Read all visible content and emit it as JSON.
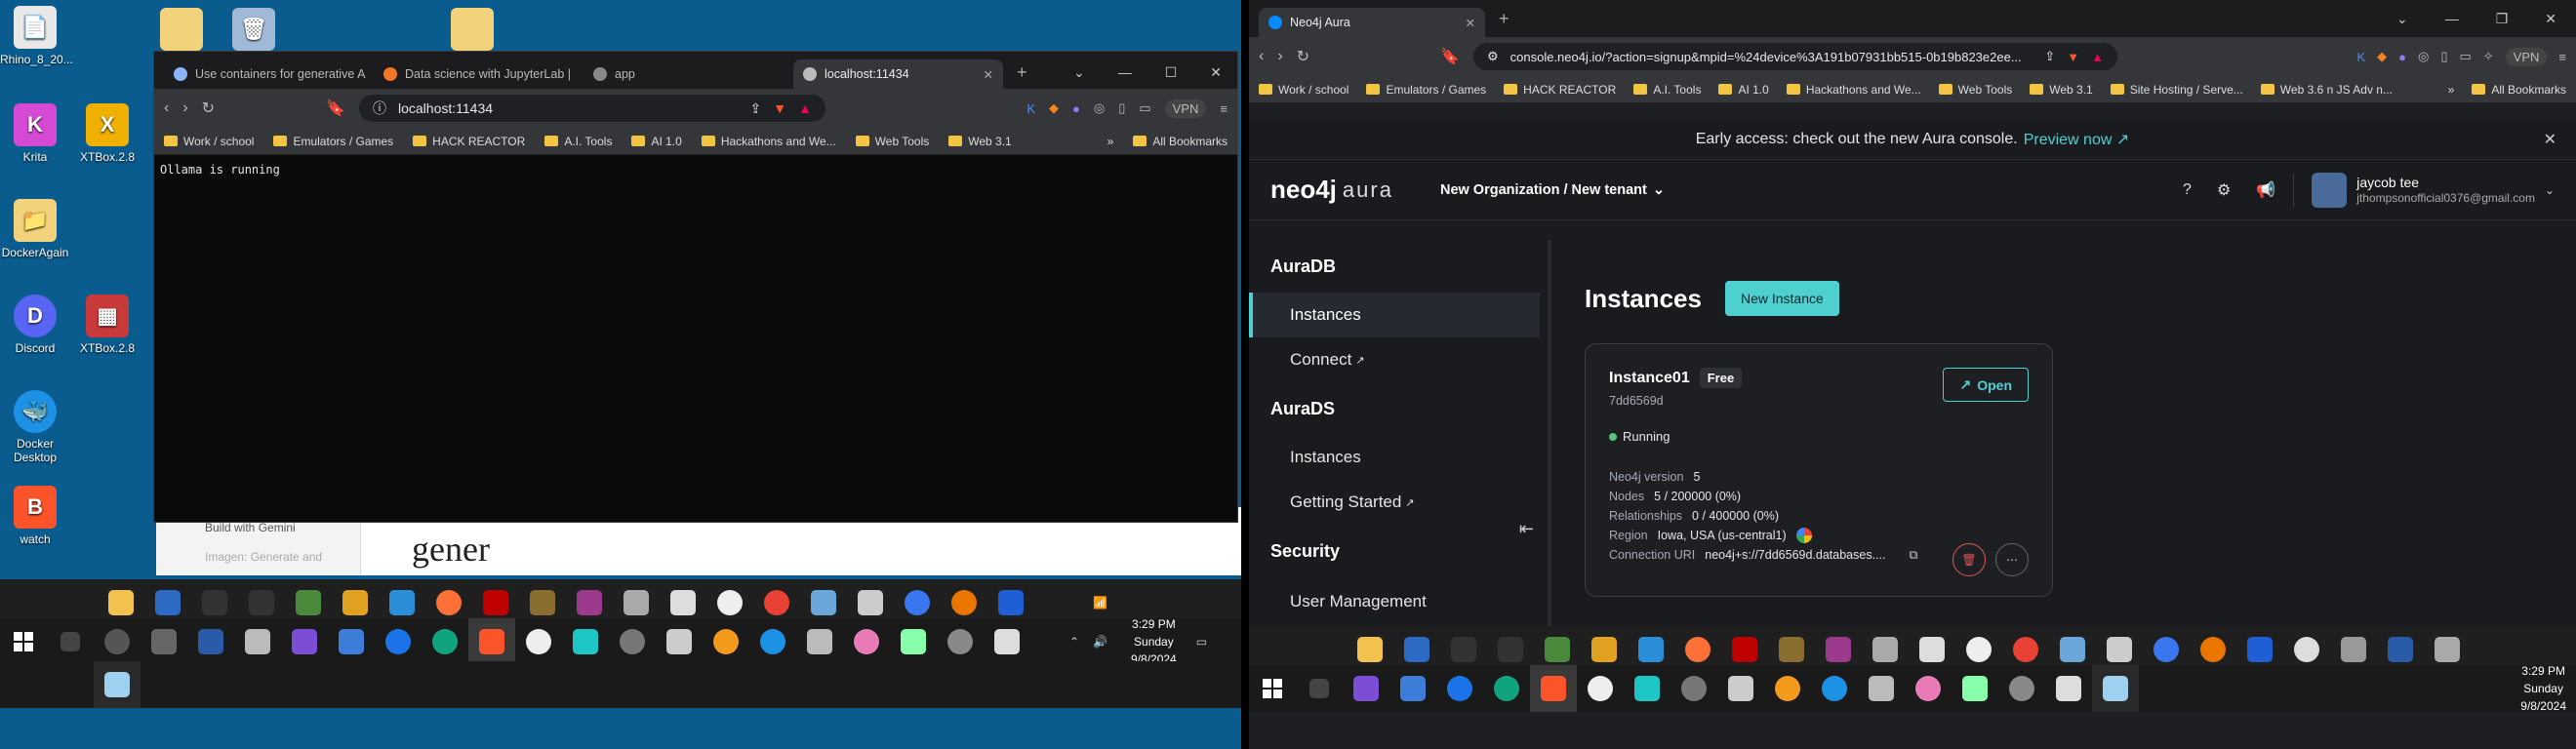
{
  "desktop_icons": [
    {
      "label": "Rhino_8_20...",
      "color": "#e8e8e8",
      "glyph": "📄"
    },
    {
      "label": "Krita",
      "color": "#d44ad4",
      "glyph": "K"
    },
    {
      "label": "DockerAgain",
      "color": "#f2d27a",
      "glyph": "📁"
    },
    {
      "label": "Discord",
      "color": "#5865f2",
      "glyph": "D"
    },
    {
      "label": "Docker Desktop",
      "color": "#1d91e6",
      "glyph": "🐳"
    },
    {
      "label": "watch",
      "color": "#fb542b",
      "glyph": "B"
    },
    {
      "label": "XTBox.2.8",
      "color": "#f0b000",
      "glyph": "X"
    },
    {
      "label": "XTBox.2.8",
      "color": "#c93a3a",
      "glyph": "▦"
    }
  ],
  "left_browser": {
    "tabs": [
      {
        "title": "Use containers for generative A"
      },
      {
        "title": "Data science with JupyterLab |"
      },
      {
        "title": "app"
      },
      {
        "title": "localhost:11434"
      }
    ],
    "url": "localhost:11434",
    "vpn": "VPN",
    "badge_count": "1",
    "bookmarks": [
      "Work / school",
      "Emulators / Games",
      "HACK REACTOR",
      "A.I. Tools",
      "AI 1.0",
      "Hackathons and We...",
      "Web Tools",
      "Web 3.1"
    ],
    "all_bookmarks": "All Bookmarks",
    "page_text": "Ollama is running",
    "behind_text_1": "Build with Gemini",
    "behind_text_2": "Imagen: Generate and",
    "behind_heading": "gener"
  },
  "left_taskbar": {
    "time": "3:29 PM",
    "day": "Sunday",
    "date": "9/8/2024"
  },
  "right_browser": {
    "tab": "Neo4j Aura",
    "url": "console.neo4j.io/?action=signup&mpid=%24device%3A191b07931bb515-0b19b823e2ee...",
    "vpn": "VPN",
    "bookmarks": [
      "Work / school",
      "Emulators / Games",
      "HACK REACTOR",
      "A.I. Tools",
      "AI 1.0",
      "Hackathons and We...",
      "Web Tools",
      "Web 3.1",
      "Site Hosting / Serve...",
      "Web 3.6 n JS Adv n..."
    ],
    "all_bookmarks": "All Bookmarks"
  },
  "neo4j": {
    "banner_text": "Early access: check out the new Aura console.",
    "banner_link": "Preview now ↗",
    "logo_main": "neo4j",
    "logo_sub": "aura",
    "org": "New Organization / New tenant",
    "user_name": "jaycob tee",
    "user_email": "jthompsonofficial0376@gmail.com",
    "sidebar": {
      "auradb": "AuraDB",
      "auradb_instances": "Instances",
      "connect": "Connect",
      "auradS": "AuraDS",
      "auradS_instances": "Instances",
      "getting_started": "Getting Started",
      "security": "Security",
      "user_management": "User Management"
    },
    "page_title": "Instances",
    "new_instance": "New Instance",
    "instance": {
      "name": "Instance01",
      "tier": "Free",
      "id": "7dd6569d",
      "status": "Running",
      "open": "Open",
      "rows": [
        {
          "k": "Neo4j version",
          "v": "5"
        },
        {
          "k": "Nodes",
          "v": "5 / 200000 (0%)"
        },
        {
          "k": "Relationships",
          "v": "0 / 400000 (0%)"
        },
        {
          "k": "Region",
          "v": "Iowa, USA (us-central1)"
        },
        {
          "k": "Connection URI",
          "v": "neo4j+s://7dd6569d.databases...."
        }
      ]
    }
  },
  "right_taskbar": {
    "time": "3:29 PM",
    "day": "Sunday",
    "date": "9/8/2024"
  },
  "colors": {
    "accent": "#4ed0d0",
    "running": "#57c57b",
    "danger": "#e05555"
  }
}
